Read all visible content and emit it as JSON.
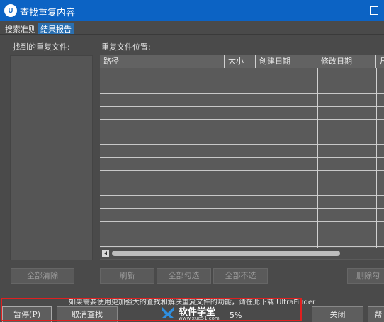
{
  "window": {
    "icon_text": "U",
    "title": "查找重复内容"
  },
  "tabs": [
    {
      "label": "搜索准则",
      "active": false
    },
    {
      "label": "结果报告",
      "active": true
    }
  ],
  "panels": {
    "found_label": "找到的重复文件:",
    "location_label": "重复文件位置:"
  },
  "table": {
    "columns": [
      "路径",
      "大小",
      "创建日期",
      "修改日期",
      "尺"
    ],
    "rows": []
  },
  "buttons": {
    "clear_all": "全部清除",
    "refresh": "刷新",
    "select_all": "全部勾选",
    "deselect_all": "全部不选",
    "delete": "删除勾"
  },
  "upsell_text": "如果需要使用更加强大的查找和解决重复文件的功能，请在此下载 UltraFinder",
  "bottom": {
    "pause": "暂停(P)",
    "cancel_search": "取消查找",
    "progress": "5%",
    "close": "关闭",
    "extra": "帮"
  },
  "watermark": {
    "name": "软件学堂",
    "url": "www.xue51.com"
  },
  "colors": {
    "titlebar": "#0c63c4",
    "active_tab": "#2a6fb0",
    "highlight": "#e02020",
    "background": "#4a4a4a"
  }
}
